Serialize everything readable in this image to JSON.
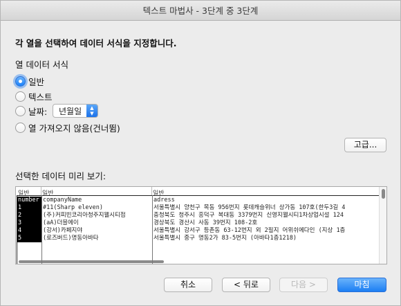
{
  "window": {
    "title": "텍스트 마법사 - 3단계 중 3단계"
  },
  "heading": "각 열을 선택하여 데이터 서식을 지정합니다.",
  "column_format": {
    "label": "열 데이터 서식",
    "options": {
      "general": "일반",
      "text": "텍스트",
      "date": "날짜:",
      "skip": "열 가져오지 않음(건너뜀)"
    },
    "selected": "general",
    "date_value": "년월일"
  },
  "buttons": {
    "advanced": "고급...",
    "cancel": "취소",
    "back": "< 뒤로",
    "next": "다음 >",
    "finish": "마침"
  },
  "preview": {
    "label": "선택한 데이터 미리 보기:",
    "headers": [
      "일반",
      "일반",
      "일반"
    ],
    "rows": [
      [
        "number",
        "companyName",
        "adress"
      ],
      [
        "1",
        "#11(Sharp eleven)",
        "서울특별시 양천구 목동 956번지 롯데캐슬위너 상가동 107호(한두3길 4"
      ],
      [
        "2",
        "(주)커피빈코리아청주지웰시티점",
        "충청북도 청주시 흥덕구 복대동 3379번지 신영지웰시티1차상업시설 124"
      ],
      [
        "3",
        "(aA)더블에이",
        "경상북도 경산시 사동 39번지 108-2호"
      ],
      [
        "4",
        "(강서)카페지야",
        "서울특별시 강서구 등촌동 63-12번지 외 2필지 어위쉬에다인 (지상 1층"
      ],
      [
        "5",
        "(로즈버드)명동아바타",
        "서울특별시 중구 명동2가 83-5번지 (아바타1층1218)"
      ]
    ]
  },
  "colors": {
    "accent": "#1c7ef3",
    "window_bg": "#ececec"
  }
}
